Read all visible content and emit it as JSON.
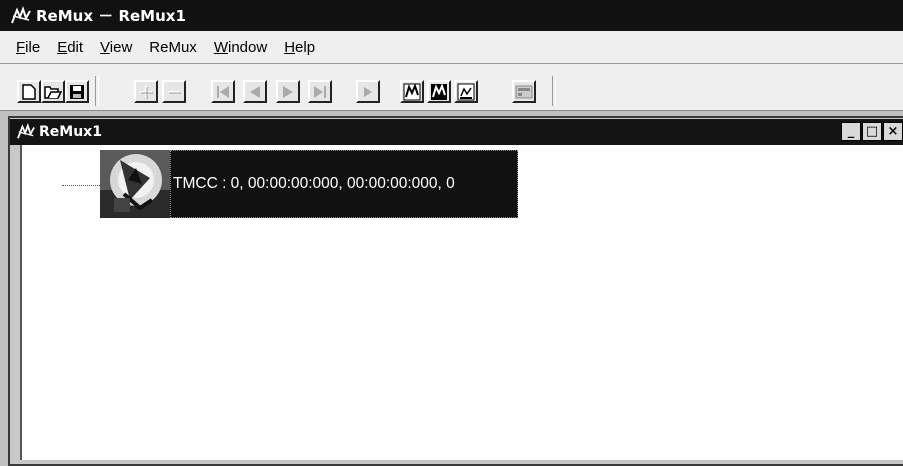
{
  "app": {
    "title": "ReMux － ReMux1",
    "icon": "remux-logo-icon"
  },
  "menu": [
    "File",
    "Edit",
    "View",
    "ReMux",
    "Window",
    "Help"
  ],
  "toolbar": [
    {
      "name": "new-document-icon"
    },
    {
      "name": "open-folder-icon"
    },
    {
      "name": "save-icon"
    },
    {
      "name": "add-icon",
      "disabled": true
    },
    {
      "name": "remove-icon",
      "disabled": true
    },
    {
      "name": "skip-to-start-icon",
      "disabled": true
    },
    {
      "name": "step-back-icon",
      "disabled": true
    },
    {
      "name": "step-forward-icon",
      "disabled": true
    },
    {
      "name": "skip-to-end-icon",
      "disabled": true
    },
    {
      "name": "play-icon",
      "disabled": true
    },
    {
      "name": "remux-tool-1-icon"
    },
    {
      "name": "remux-tool-2-icon"
    },
    {
      "name": "remux-tool-3-icon"
    },
    {
      "name": "settings-panel-icon",
      "disabled": true
    }
  ],
  "child_window": {
    "title": "ReMux1",
    "controls": [
      "_",
      "□",
      "×"
    ]
  },
  "tree": {
    "item_icon": "stream-thumbnail-icon",
    "item_label": "TMCC : 0, 00:00:00:000, 00:00:00:000, 0"
  }
}
